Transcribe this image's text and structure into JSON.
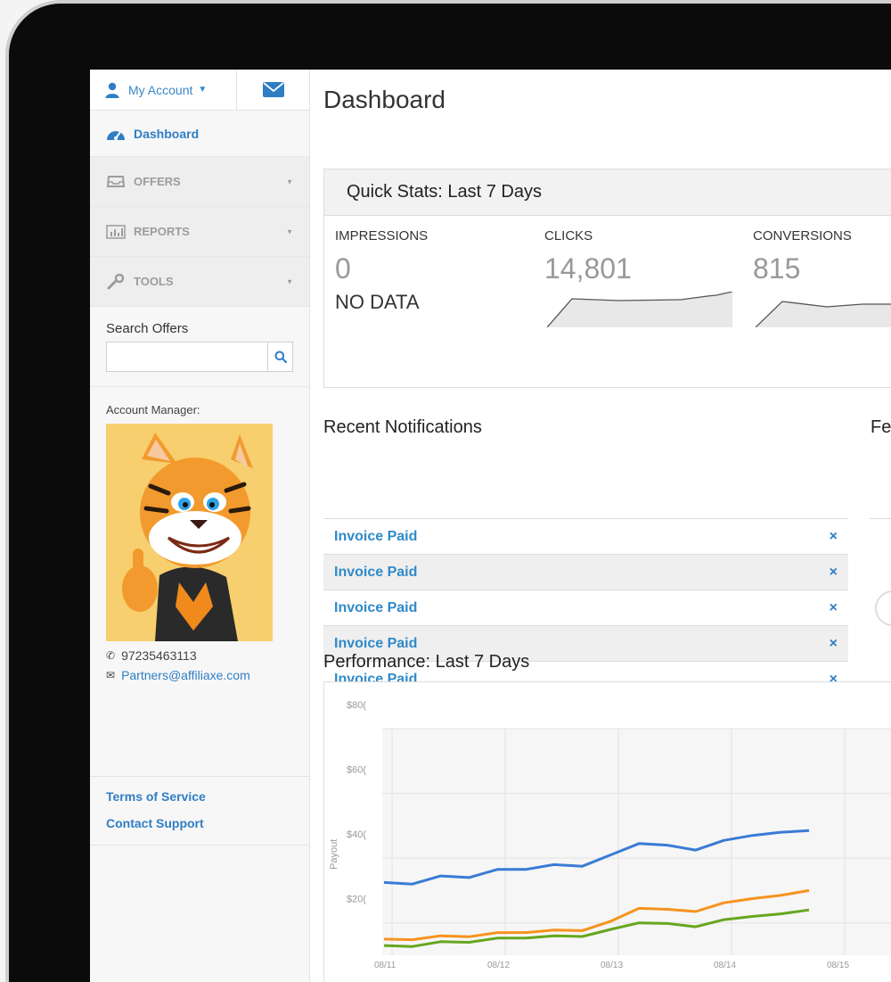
{
  "sidebar": {
    "account_label": "My Account",
    "nav": [
      {
        "label": "Dashboard"
      },
      {
        "label": "OFFERS"
      },
      {
        "label": "REPORTS"
      },
      {
        "label": "TOOLS"
      }
    ],
    "search_label": "Search Offers",
    "search_value": "",
    "manager_label": "Account Manager:",
    "phone": "97235463113",
    "email": "Partners@affiliaxe.com",
    "footer_links": [
      "Terms of Service",
      "Contact Support"
    ]
  },
  "main": {
    "title": "Dashboard",
    "quick_stats": {
      "title": "Quick Stats: Last 7 Days",
      "stats": [
        {
          "label": "IMPRESSIONS",
          "value": "0",
          "note": "NO DATA"
        },
        {
          "label": "CLICKS",
          "value": "14,801"
        },
        {
          "label": "CONVERSIONS",
          "value": "815"
        }
      ]
    },
    "notifications_title": "Recent Notifications",
    "notifications": [
      "Invoice Paid",
      "Invoice Paid",
      "Invoice Paid",
      "Invoice Paid",
      "Invoice Paid"
    ],
    "notification_close": "×",
    "fe_title": "Fe",
    "performance_title": "Performance: Last 7 Days"
  },
  "chart_data": {
    "type": "line",
    "title": "",
    "ylabel": "Payout",
    "y_ticks": [
      "$80(",
      "$60(",
      "$40(",
      "$20("
    ],
    "x": [
      "08/11",
      "08/12",
      "08/13",
      "08/14",
      "08/15"
    ],
    "ylim": [
      100,
      800
    ],
    "series": [
      {
        "color": "#3a7bd5",
        "values": [
          325,
          320,
          345,
          340,
          365,
          365,
          380,
          375,
          410,
          445,
          440,
          425,
          455,
          470,
          480,
          485
        ]
      },
      {
        "color": "#f7931e",
        "values": [
          150,
          148,
          160,
          157,
          170,
          170,
          178,
          176,
          205,
          245,
          242,
          235,
          262,
          275,
          285,
          300
        ]
      },
      {
        "color": "#66a61e",
        "values": [
          130,
          127,
          142,
          140,
          153,
          153,
          160,
          158,
          180,
          200,
          198,
          188,
          210,
          220,
          228,
          240
        ]
      }
    ],
    "grid": true
  },
  "colors": {
    "accent": "#2f7ec4",
    "frame": "#0b0b0b"
  }
}
